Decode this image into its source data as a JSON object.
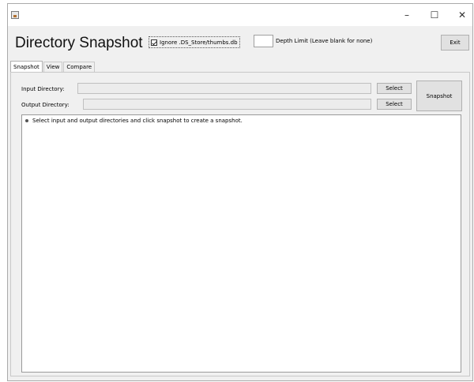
{
  "window": {
    "controls": {
      "minimize": "–",
      "maximize": "☐",
      "close": "✕"
    }
  },
  "header": {
    "title": "Directory Snapshot",
    "ignore_checkbox": {
      "label": "Ignore .DS_Store/thumbs.db",
      "checked": true
    },
    "depth_limit": {
      "value": "",
      "label": "Depth Limit (Leave blank for none)"
    },
    "exit_label": "Exit"
  },
  "tabs": [
    {
      "label": "Snapshot",
      "active": true
    },
    {
      "label": "View",
      "active": false
    },
    {
      "label": "Compare",
      "active": false
    }
  ],
  "snapshot_tab": {
    "input_label": "Input Directory:",
    "input_value": "",
    "input_select": "Select",
    "output_label": "Output Directory:",
    "output_value": "",
    "output_select": "Select",
    "snapshot_button": "Snapshot",
    "log": [
      "Select input and output directories and click snapshot to create a snapshot."
    ]
  }
}
